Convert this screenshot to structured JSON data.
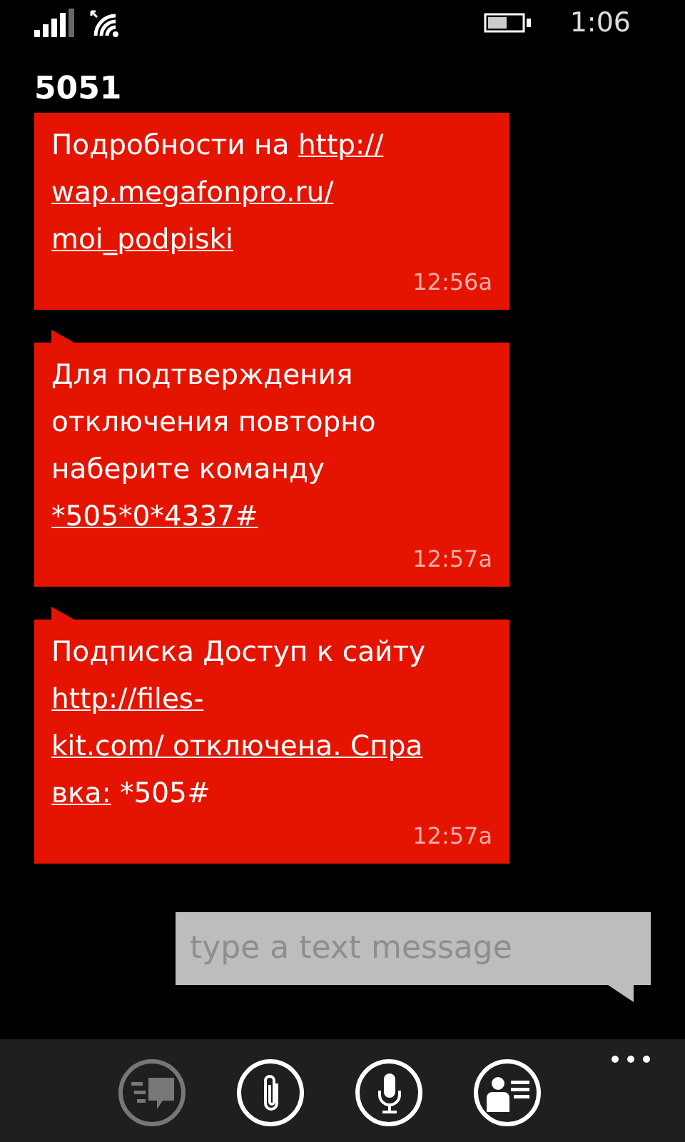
{
  "status_bar": {
    "time": "1:06"
  },
  "title": "5051",
  "messages": [
    {
      "lines": [
        [
          {
            "text": "Подробности на ",
            "link": false
          },
          {
            "text": "http://",
            "link": true
          }
        ],
        [
          {
            "text": "wap.megafonpro.ru/",
            "link": true
          }
        ],
        [
          {
            "text": "moi_podpiski",
            "link": true
          }
        ]
      ],
      "time": "12:56a",
      "tail": false
    },
    {
      "lines": [
        [
          {
            "text": "Для подтверждения",
            "link": false
          }
        ],
        [
          {
            "text": "отключения повторно",
            "link": false
          }
        ],
        [
          {
            "text": "наберите команду",
            "link": false
          }
        ],
        [
          {
            "text": "*505*0*4337#",
            "link": true
          }
        ]
      ],
      "time": "12:57a",
      "tail": true
    },
    {
      "lines": [
        [
          {
            "text": "Подписка Доступ к сайту",
            "link": false
          }
        ],
        [
          {
            "text": "http://files-",
            "link": true
          }
        ],
        [
          {
            "text": "kit.com/ отключена. Спра",
            "link": true
          }
        ],
        [
          {
            "text": "вка:",
            "link": true
          },
          {
            "text": " *505#",
            "link": false
          }
        ]
      ],
      "time": "12:57a",
      "tail": true
    }
  ],
  "input": {
    "placeholder": "type a text message"
  },
  "app_bar": {
    "buttons": [
      {
        "kind": "switch",
        "disabled": true
      },
      {
        "kind": "attach",
        "disabled": false
      },
      {
        "kind": "voice",
        "disabled": false
      },
      {
        "kind": "contact",
        "disabled": false
      }
    ]
  }
}
